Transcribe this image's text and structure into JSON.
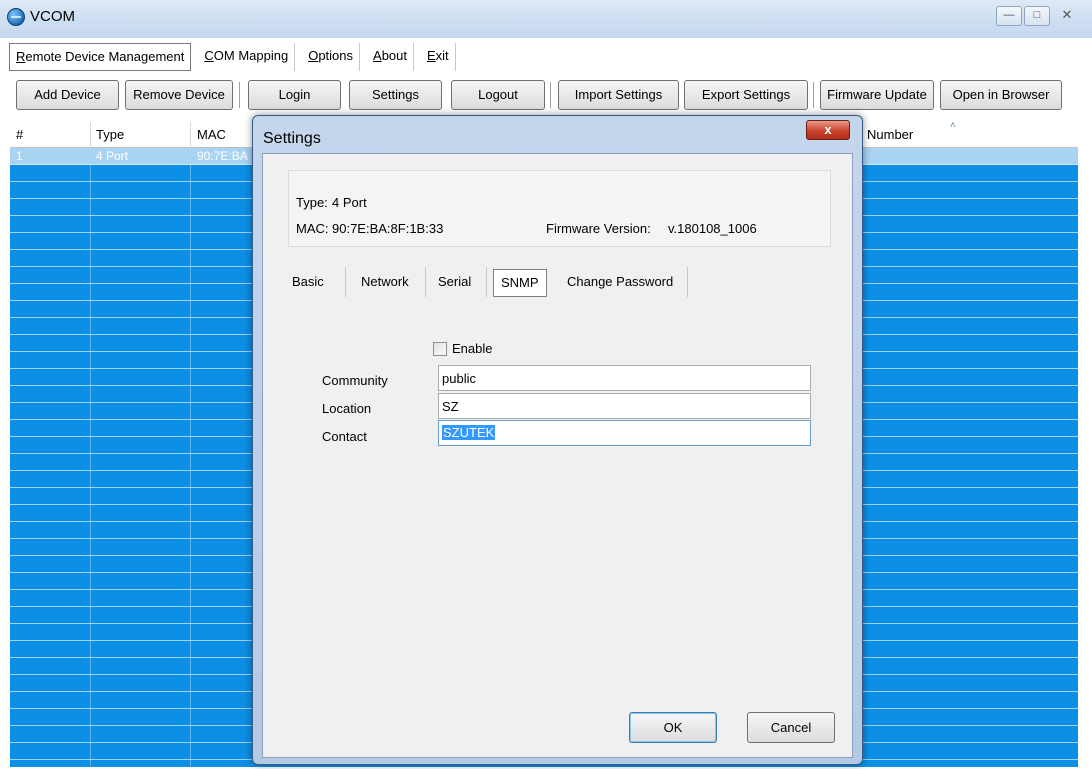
{
  "window": {
    "title": "VCOM"
  },
  "menu": [
    {
      "label": "Remote Device Management",
      "ul": "R",
      "rest": "emote Device Management"
    },
    {
      "label": "COM Mapping",
      "ul": "C",
      "rest": "OM Mapping"
    },
    {
      "label": "Options",
      "ul": "O",
      "rest": "ptions"
    },
    {
      "label": "About",
      "ul": "A",
      "rest": "bout"
    },
    {
      "label": "Exit",
      "ul": "E",
      "rest": "xit"
    }
  ],
  "toolbar": {
    "add_device": "Add Device",
    "remove_device": "Remove Device",
    "login": "Login",
    "settings": "Settings",
    "logout": "Logout",
    "import_settings": "Import Settings",
    "export_settings": "Export Settings",
    "firmware_update": "Firmware Update",
    "open_in_browser": "Open in Browser"
  },
  "device_table": {
    "columns": [
      "#",
      "Type",
      "MAC",
      "Number"
    ],
    "rows": [
      {
        "index": "1",
        "type": "4 Port",
        "mac": "90:7E:BA"
      }
    ]
  },
  "dialog": {
    "title": "Settings",
    "close_glyph": "x",
    "info": {
      "type_label": "Type:",
      "type_value": "4 Port",
      "mac_label": "MAC:",
      "mac_value": "90:7E:BA:8F:1B:33",
      "fw_label": "Firmware Version:",
      "fw_value": "v.180108_1006"
    },
    "tabs": [
      "Basic",
      "Network",
      "Serial",
      "SNMP",
      "Change Password"
    ],
    "active_tab": "SNMP",
    "snmp": {
      "enable_label": "Enable",
      "enable_checked": false,
      "community_label": "Community",
      "community_value": "public",
      "location_label": "Location",
      "location_value": "SZ",
      "contact_label": "Contact",
      "contact_value": "SZUTEK"
    },
    "ok_label": "OK",
    "cancel_label": "Cancel"
  }
}
